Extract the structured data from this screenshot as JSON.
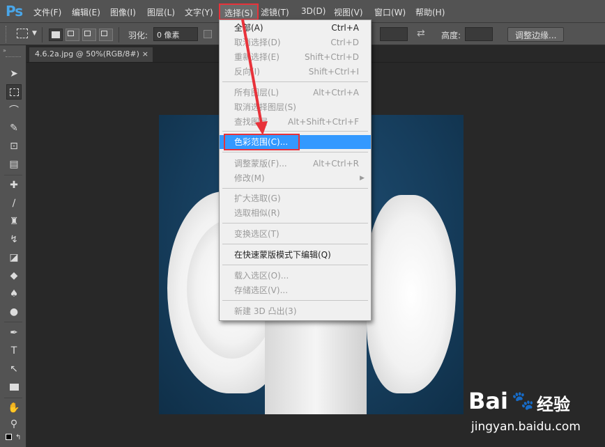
{
  "app": {
    "logo": "Ps",
    "brand_color": "#49a6e9"
  },
  "menubar": {
    "items": [
      {
        "label": "文件(F)"
      },
      {
        "label": "编辑(E)"
      },
      {
        "label": "图像(I)"
      },
      {
        "label": "图层(L)"
      },
      {
        "label": "文字(Y)"
      },
      {
        "label": "选择(S)"
      },
      {
        "label": "滤镜(T)"
      },
      {
        "label": "3D(D)"
      },
      {
        "label": "视图(V)"
      },
      {
        "label": "窗口(W)"
      },
      {
        "label": "帮助(H)"
      }
    ],
    "active": "选择(S)"
  },
  "options": {
    "feather_label": "羽化:",
    "feather_value": "0 像素",
    "height_label": "高度:",
    "refine_edge_button": "调整边缘..."
  },
  "document_tab": {
    "title": "4.6.2a.jpg @ 50%(RGB/8#)",
    "close": "×"
  },
  "select_menu": {
    "groups": [
      [
        {
          "label": "全部(A)",
          "shortcut": "Ctrl+A",
          "enabled": true
        },
        {
          "label": "取消选择(D)",
          "shortcut": "Ctrl+D",
          "enabled": false
        },
        {
          "label": "重新选择(E)",
          "shortcut": "Shift+Ctrl+D",
          "enabled": false
        },
        {
          "label": "反向(I)",
          "shortcut": "Shift+Ctrl+I",
          "enabled": false
        }
      ],
      [
        {
          "label": "所有图层(L)",
          "shortcut": "Alt+Ctrl+A",
          "enabled": false
        },
        {
          "label": "取消选择图层(S)",
          "shortcut": "",
          "enabled": false
        },
        {
          "label": "查找图层",
          "shortcut": "Alt+Shift+Ctrl+F",
          "enabled": false
        }
      ],
      [
        {
          "label": "色彩范围(C)...",
          "shortcut": "",
          "enabled": true,
          "highlighted": true
        }
      ],
      [
        {
          "label": "调整蒙版(F)...",
          "shortcut": "Alt+Ctrl+R",
          "enabled": false
        },
        {
          "label": "修改(M)",
          "shortcut": "",
          "enabled": false,
          "submenu": true
        }
      ],
      [
        {
          "label": "扩大选取(G)",
          "shortcut": "",
          "enabled": false
        },
        {
          "label": "选取相似(R)",
          "shortcut": "",
          "enabled": false
        }
      ],
      [
        {
          "label": "变换选区(T)",
          "shortcut": "",
          "enabled": false
        }
      ],
      [
        {
          "label": "在快速蒙版模式下编辑(Q)",
          "shortcut": "",
          "enabled": true
        }
      ],
      [
        {
          "label": "载入选区(O)...",
          "shortcut": "",
          "enabled": false
        },
        {
          "label": "存储选区(V)...",
          "shortcut": "",
          "enabled": false
        }
      ],
      [
        {
          "label": "新建 3D 凸出(3)",
          "shortcut": "",
          "enabled": false
        }
      ]
    ]
  },
  "watermark": {
    "brand": "Bai",
    "brand_suffix": "经验",
    "url": "jingyan.baidu.com"
  },
  "colors": {
    "highlight": "#3399ff",
    "annotation_red": "#e8323a"
  }
}
